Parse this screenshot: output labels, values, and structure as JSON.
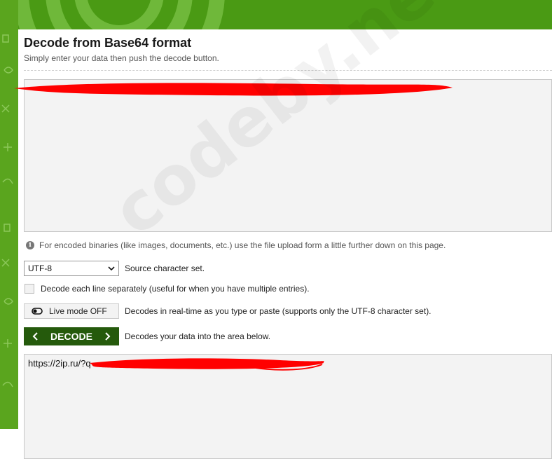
{
  "header": {
    "title": "Decode from Base64 format",
    "subtitle": "Simply enter your data then push the decode button."
  },
  "input": {
    "value": ""
  },
  "info": {
    "icon": "info-icon",
    "text": "For encoded binaries (like images, documents, etc.) use the file upload form a little further down on this page."
  },
  "charset": {
    "selected": "UTF-8",
    "label": "Source character set."
  },
  "line_option": {
    "label": "Decode each line separately (useful for when you have multiple entries).",
    "checked": false
  },
  "live_mode": {
    "button_label": "Live mode OFF",
    "description": "Decodes in real-time as you type or paste (supports only the UTF-8 character set)."
  },
  "decode": {
    "button_label": "DECODE",
    "description": "Decodes your data into the area below."
  },
  "output": {
    "value": "https://2ip.ru/?q"
  },
  "watermark": {
    "text": "codeby.net"
  },
  "colors": {
    "header_green": "#4a9a14",
    "strip_green": "#5aa51e",
    "decode_button": "#255a0c",
    "redaction": "#ff0000"
  }
}
